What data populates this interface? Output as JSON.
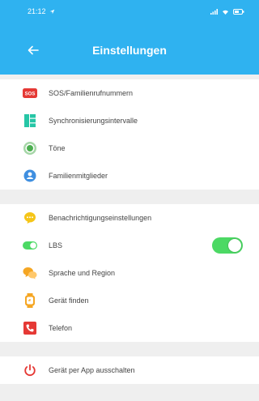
{
  "status_bar": {
    "time": "21:12"
  },
  "header": {
    "title": "Einstellungen"
  },
  "groups": [
    {
      "items": [
        {
          "label": "SOS/Familienrufnummern",
          "icon": "sos-icon"
        },
        {
          "label": "Synchronisierungsintervalle",
          "icon": "sync-interval-icon"
        },
        {
          "label": "Töne",
          "icon": "sound-icon"
        },
        {
          "label": "Familienmitglieder",
          "icon": "family-members-icon"
        }
      ]
    },
    {
      "items": [
        {
          "label": "Benachrichtigungseinstellungen",
          "icon": "notification-icon"
        },
        {
          "label": "LBS",
          "icon": "lbs-toggle-icon",
          "toggle": true
        },
        {
          "label": "Sprache und Region",
          "icon": "language-icon"
        },
        {
          "label": "Gerät finden",
          "icon": "find-device-icon"
        },
        {
          "label": "Telefon",
          "icon": "phone-icon"
        }
      ]
    },
    {
      "items": [
        {
          "label": "Gerät per App ausschalten",
          "icon": "power-icon"
        }
      ]
    }
  ],
  "colors": {
    "header_bg": "#2fb2f0",
    "toggle_on": "#4cd964",
    "sos_red": "#e53935",
    "sync_green": "#26c6a6",
    "sound_green": "#4caf50",
    "family_blue": "#3f8fe0",
    "notify_yellow": "#f5c518",
    "lang_orange": "#f5a623",
    "phone_red": "#e53935",
    "power_red": "#e53935"
  }
}
